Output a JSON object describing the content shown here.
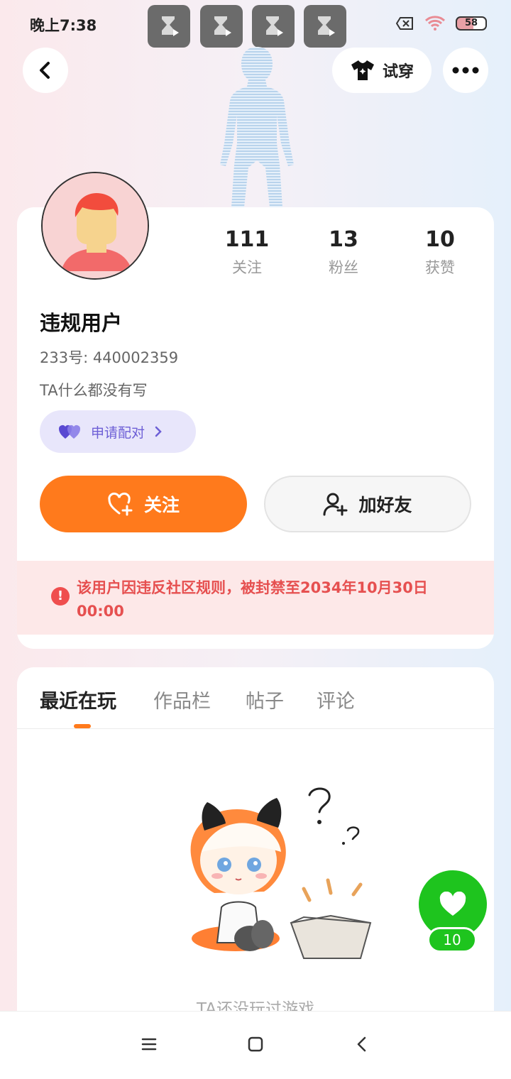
{
  "status_bar": {
    "time": "晚上7:38",
    "battery": "58",
    "notification_icons": [
      "hourglass-video-icon",
      "hourglass-video-icon",
      "hourglass-video-icon",
      "hourglass-video-icon"
    ]
  },
  "header": {
    "back_icon": "chevron-left-icon",
    "tryon_label": "试穿",
    "more_icon": "more-dots-icon"
  },
  "profile": {
    "stats": [
      {
        "value": "111",
        "label": "关注"
      },
      {
        "value": "13",
        "label": "粉丝"
      },
      {
        "value": "10",
        "label": "获赞"
      }
    ],
    "username": "违规用户",
    "uid": "233号: 440002359",
    "bio": "TA什么都没有写",
    "pair_label": "申请配对",
    "follow_label": "关注",
    "add_friend_label": "加好友",
    "ban_notice": "该用户因违反社区规则，被封禁至2034年10月30日 00:00"
  },
  "tabs": [
    {
      "label": "最近在玩",
      "active": true
    },
    {
      "label": "作品栏",
      "active": false
    },
    {
      "label": "帖子",
      "active": false
    },
    {
      "label": "评论",
      "active": false
    }
  ],
  "empty_state": {
    "text": "TA还没玩过游戏"
  },
  "like_fab": {
    "count": "10"
  },
  "colors": {
    "accent": "#ff7a1c",
    "like": "#1ec41e",
    "ban": "#e65050",
    "pair": "#6d5fd6"
  },
  "nav": [
    "menu-icon",
    "home-icon",
    "back-icon"
  ]
}
